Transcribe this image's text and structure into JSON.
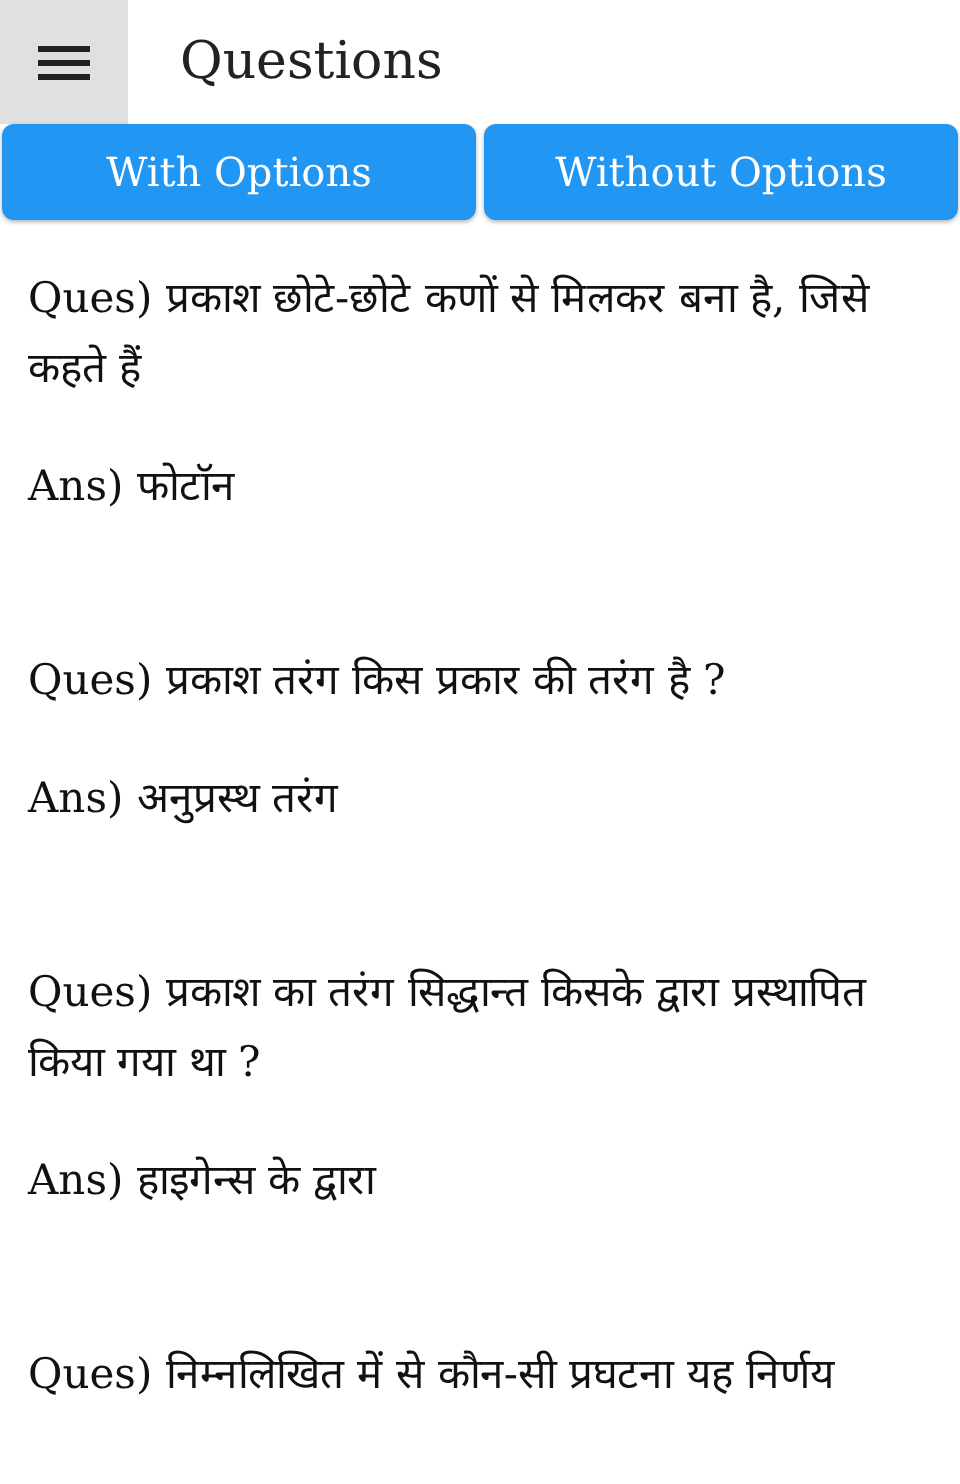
{
  "app_bar": {
    "title": "Questions"
  },
  "tabs": [
    {
      "label": "With Options"
    },
    {
      "label": "Without Options"
    }
  ],
  "items": [
    {
      "question": "Ques) प्रकाश छोटे-छोटे कणों से मिलकर बना है, जिसे कहते हैं",
      "answer": "Ans) फोटॉन"
    },
    {
      "question": "Ques) प्रकाश तरंग किस प्रकार की तरंग है ?",
      "answer": "Ans) अनुप्रस्थ तरंग"
    },
    {
      "question": "Ques) प्रकाश का तरंग सिद्धान्त किसके द्वारा प्रस्थापित किया गया था ?",
      "answer": "Ans) हाइगेन्स के द्वारा"
    },
    {
      "question": "Ques) निम्नलिखित में से कौन-सी प्रघटना यह निर्णय"
    }
  ]
}
